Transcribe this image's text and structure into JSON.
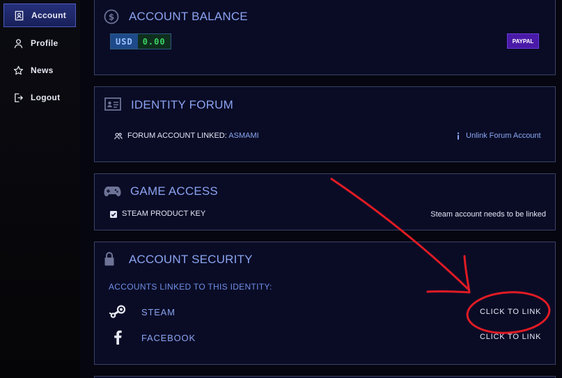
{
  "sidebar": {
    "items": [
      {
        "label": "Account",
        "icon": "badge-icon",
        "active": true
      },
      {
        "label": "Profile",
        "icon": "user-icon"
      },
      {
        "label": "News",
        "icon": "star-icon"
      },
      {
        "label": "Logout",
        "icon": "logout-icon"
      }
    ]
  },
  "balance": {
    "title": "ACCOUNT BALANCE",
    "currency": "USD",
    "amount": "0.00",
    "paypal_label": "PAYPAL"
  },
  "forum": {
    "title": "IDENTITY FORUM",
    "linked_prefix": "FORUM ACCOUNT LINKED: ",
    "username": "ASMAMI",
    "unlink_label": "Unlink Forum Account"
  },
  "game": {
    "title": "GAME ACCESS",
    "product_label": "STEAM PRODUCT KEY",
    "status_text": "Steam account needs to be linked"
  },
  "security": {
    "title": "ACCOUNT SECURITY",
    "subtitle": "ACCOUNTS LINKED TO THIS IDENTITY:",
    "accounts": [
      {
        "name": "STEAM",
        "icon": "steam-icon",
        "action": "CLICK TO LINK"
      },
      {
        "name": "FACEBOOK",
        "icon": "facebook-icon",
        "action": "CLICK TO LINK"
      }
    ]
  },
  "colors": {
    "panel_bg": "#0a0c26",
    "accent": "#8aa3f0",
    "annotation": "#e01b24"
  }
}
